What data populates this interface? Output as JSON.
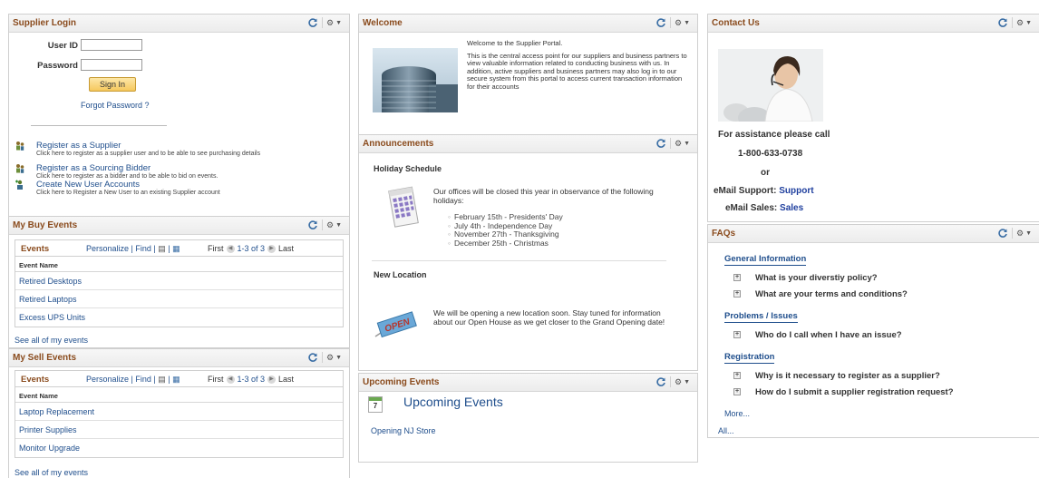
{
  "supplier_login": {
    "title": "Supplier Login",
    "user_id_label": "User ID",
    "user_id_value": "",
    "password_label": "Password",
    "password_value": "",
    "sign_in": "Sign In",
    "forgot": "Forgot Password ?",
    "register_supplier": {
      "title": "Register as a Supplier",
      "desc": "Click here to register as a supplier user and to be able to see purchasing details"
    },
    "register_bidder": {
      "title": "Register as a Sourcing Bidder",
      "desc": "Click here to register as a bidder and to be able to bid on events."
    },
    "create_accounts": {
      "title": "Create New User Accounts",
      "desc": "Click here to Register a New User to an existing Supplier account"
    }
  },
  "buy_events": {
    "title": "My Buy Events",
    "grid_title": "Events",
    "personalize": "Personalize",
    "find": "Find",
    "first": "First",
    "range": "1-3 of 3",
    "last": "Last",
    "column": "Event Name",
    "rows": [
      "Retired Desktops",
      "Retired Laptops",
      "Excess UPS Units"
    ],
    "see_all": "See all of my events"
  },
  "sell_events": {
    "title": "My Sell Events",
    "grid_title": "Events",
    "personalize": "Personalize",
    "find": "Find",
    "first": "First",
    "range": "1-3 of 3",
    "last": "Last",
    "column": "Event Name",
    "rows": [
      "Laptop Replacement",
      "Printer Supplies",
      "Monitor Upgrade"
    ],
    "see_all": "See all of my events"
  },
  "welcome": {
    "title": "Welcome",
    "line1": "Welcome to the Supplier Portal.",
    "line2": "This is the central access point for our suppliers and business partners to view valuable information related to conducting business with us. In addition, active suppliers and business partners may also log in to our secure system from this portal to access current transaction information for their accounts"
  },
  "announcements": {
    "title": "Announcements",
    "holiday_heading": "Holiday Schedule",
    "holiday_text": "Our offices will be closed this year in observance of the following holidays:",
    "holidays": [
      "February 15th - Presidents' Day",
      "July 4th - Independence Day",
      "November 27th - Thanksgiving",
      "December 25th - Christmas"
    ],
    "location_heading": "New Location",
    "location_text": "We will be opening a new location soon. Stay tuned for information about our Open House as we get closer to the Grand Opening date!",
    "open_sign": "OPEN"
  },
  "upcoming": {
    "title": "Upcoming Events",
    "heading": "Upcoming Events",
    "calendar_day": "7",
    "item": "Opening NJ Store"
  },
  "contact": {
    "title": "Contact Us",
    "assist": "For assistance please call",
    "phone": "1-800-633-0738",
    "or": "or",
    "email_support_label": "eMail Support:",
    "email_support_link": "Support",
    "email_sales_label": "eMail Sales:",
    "email_sales_link": "Sales"
  },
  "faqs": {
    "title": "FAQs",
    "general": "General Information",
    "q1": "What is your diverstiy policy?",
    "q2": "What are your terms and conditions?",
    "problems": "Problems / Issues",
    "q3": "Who do I call when I have an issue?",
    "registration": "Registration",
    "q4": "Why is it necessary to register as a supplier?",
    "q5": "How do I submit a supplier registration request?",
    "more": "More...",
    "all": "All..."
  },
  "colors": {
    "title_brown": "#8a4b1d",
    "link_blue": "#1f4e8c",
    "button_gold": "#f6c85d"
  }
}
